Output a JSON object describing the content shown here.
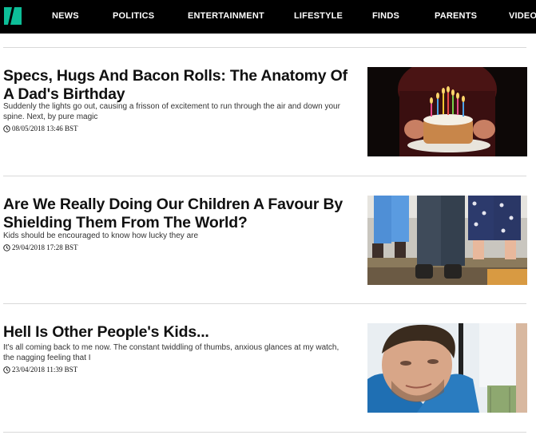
{
  "nav": {
    "items": [
      "NEWS",
      "POLITICS",
      "ENTERTAINMENT",
      "LIFESTYLE",
      "FINDS",
      "PARENTS",
      "VIDEO"
    ]
  },
  "articles": [
    {
      "title": "Specs, Hugs And Bacon Rolls: The Anatomy Of A Dad's Birthday",
      "summary": "Suddenly the lights go out, causing a frisson of excitement to run through the air and down your spine. Next, by pure magic",
      "timestamp": "08/05/2018 13:46 BST",
      "image_icon": "birthday-cake-photo"
    },
    {
      "title": "Are We Really Doing Our Children A Favour By Shielding Them From The World?",
      "summary": "Kids should be encouraged to know how lucky they are",
      "timestamp": "29/04/2018 17:28 BST",
      "image_icon": "family-legs-photo"
    },
    {
      "title": "Hell Is Other People's Kids...",
      "summary": "It's all coming back to me now. The constant twiddling of thumbs, anxious glances at my watch, the nagging feeling that I",
      "timestamp": "23/04/2018 11:39 BST",
      "image_icon": "man-portrait-photo"
    }
  ],
  "colors": {
    "brand": "#0dbe98",
    "bar": "#000000"
  }
}
